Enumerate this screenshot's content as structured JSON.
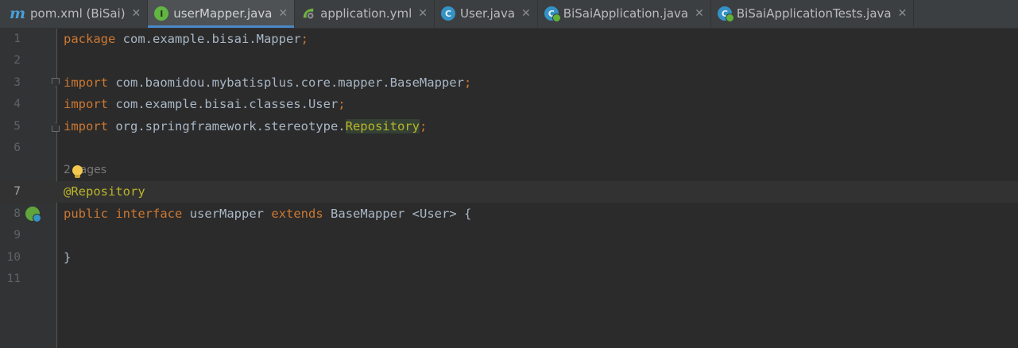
{
  "tabs": [
    {
      "label": "pom.xml (BiSai)",
      "icon": "maven-icon",
      "active": false
    },
    {
      "label": "userMapper.java",
      "icon": "interface-icon",
      "active": true
    },
    {
      "label": "application.yml",
      "icon": "spring-config-icon",
      "active": false
    },
    {
      "label": "User.java",
      "icon": "class-icon",
      "active": false
    },
    {
      "label": "BiSaiApplication.java",
      "icon": "spring-app-icon",
      "active": false
    },
    {
      "label": "BiSaiApplicationTests.java",
      "icon": "test-class-icon",
      "active": false
    }
  ],
  "tab_icon_letters": {
    "maven": "m",
    "iface": "I",
    "klass": "C"
  },
  "close_glyph": "✕",
  "editor": {
    "current_line": 7,
    "line_numbers": [
      "1",
      "2",
      "3",
      "4",
      "5",
      "6",
      "7",
      "8",
      "9",
      "10",
      "11"
    ],
    "tokens": {
      "l1_kw": "package",
      "l1_pkg": " com.example.bisai.Mapper",
      "l1_semi": ";",
      "l3_kw": "import",
      "l3_path": " com.baomidou.mybatisplus.core.mapper.BaseMapper",
      "l3_semi": ";",
      "l4_kw": "import",
      "l4_path": " com.example.bisai.classes.User",
      "l4_semi": ";",
      "l5_kw": "import",
      "l5_path": " org.springframework.stereotype.",
      "l5_hl": "Repository",
      "l5_semi": ";",
      "usages_a": "2 ",
      "usages_b": "sages",
      "l7_ann": "@Repository",
      "l8_kw1": "public",
      "l8_kw2": "interface",
      "l8_name": "userMapper",
      "l8_kw3": "extends",
      "l8_rest": "BaseMapper <User> {",
      "l10_brace": "}"
    }
  },
  "colors": {
    "keyword": "#cc7832",
    "annotation": "#bbb529",
    "default_text": "#a9b7c6",
    "background": "#2b2b2b",
    "gutter": "#313335",
    "tab_accent": "#4a88c7"
  }
}
